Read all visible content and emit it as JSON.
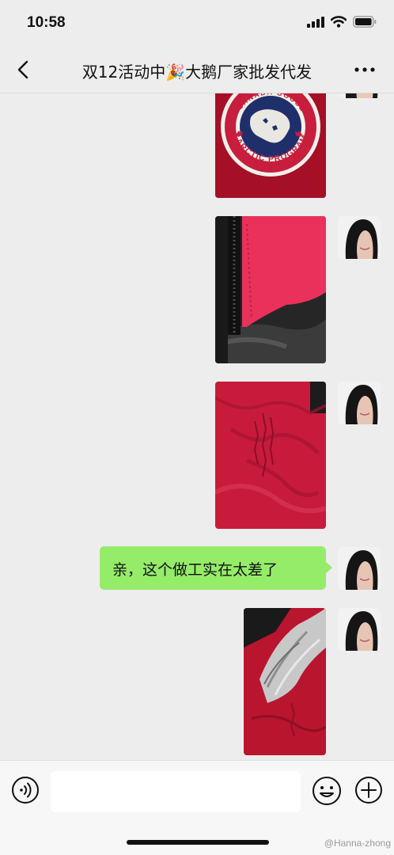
{
  "status_bar": {
    "time": "10:58"
  },
  "nav": {
    "title": "双12活动中🎉大鹅厂家批发代发"
  },
  "messages": [
    {
      "type": "image",
      "sender": "me",
      "description": "red jacket with round Arctic Program patch"
    },
    {
      "type": "image",
      "sender": "me",
      "description": "pink fabric edge with zipper"
    },
    {
      "type": "image",
      "sender": "me",
      "description": "red fabric with gathered seam"
    },
    {
      "type": "text",
      "sender": "me",
      "text": "亲，这个做工实在太差了"
    },
    {
      "type": "image",
      "sender": "me",
      "description": "red jacket with fur hood trim"
    }
  ],
  "patch": {
    "top_text": "CANADA GOOSE",
    "bottom_text": "ARCTIC PROGRAM"
  },
  "input": {
    "value": "",
    "placeholder": ""
  },
  "watermark": "@Hanna-zhong",
  "colors": {
    "background": "#ededed",
    "bubble": "#95ec69",
    "fabric_red": "#b7102c",
    "input_bar": "#f7f7f7"
  },
  "icons": {
    "back": "chevron-left-icon",
    "more": "more-dots-icon",
    "voice": "voice-icon",
    "emoji": "emoji-icon",
    "plus": "plus-icon"
  }
}
